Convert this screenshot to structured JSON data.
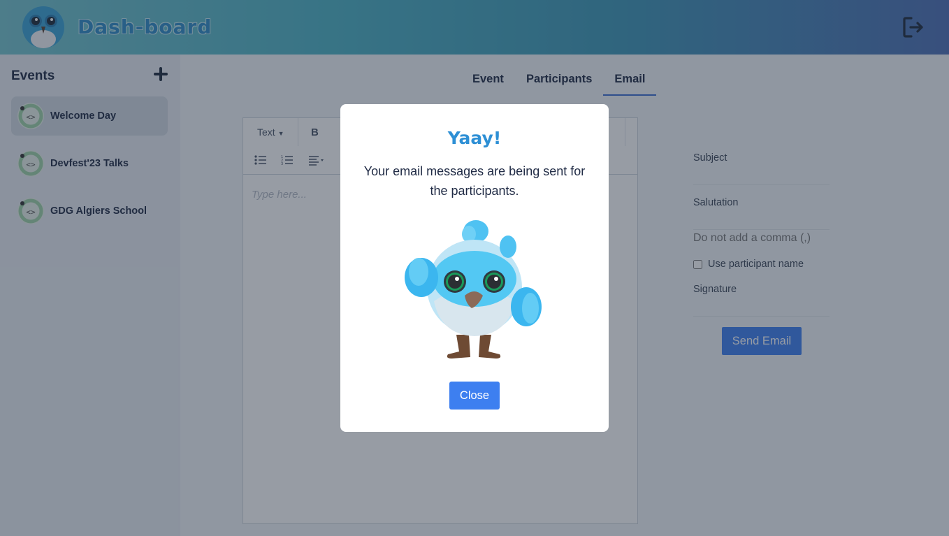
{
  "header": {
    "brand": "Dash-board",
    "logout_icon": "logout-icon"
  },
  "sidebar": {
    "title": "Events",
    "add_icon": "plus-icon",
    "items": [
      {
        "label": "Welcome Day",
        "active": true
      },
      {
        "label": "Devfest'23 Talks",
        "active": false
      },
      {
        "label": "GDG Algiers School",
        "active": false
      }
    ]
  },
  "tabs": [
    {
      "label": "Event",
      "active": false
    },
    {
      "label": "Participants",
      "active": false
    },
    {
      "label": "Email",
      "active": true
    }
  ],
  "editor": {
    "text_style_label": "Text",
    "bold_label": "B",
    "placeholder": "Type here..."
  },
  "form": {
    "subject_label": "Subject",
    "salutation_label": "Salutation",
    "salutation_placeholder": "Do not add a comma (,)",
    "use_name_label": "Use participant name",
    "use_name_checked": false,
    "signature_label": "Signature",
    "send_label": "Send Email"
  },
  "modal": {
    "title": "Yaay!",
    "message": "Your email messages are being sent for the participants.",
    "close_label": "Close"
  },
  "colors": {
    "accent": "#3d7ff0",
    "title_blue": "#2d8fd5",
    "tab_underline": "#3b6fd1"
  }
}
